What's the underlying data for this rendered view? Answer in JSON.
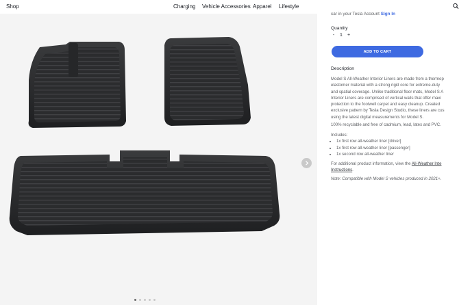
{
  "header": {
    "shop": "Shop",
    "nav": [
      "Charging",
      "Vehicle Accessories",
      "Apparel",
      "Lifestyle"
    ]
  },
  "gallery": {
    "dot_count": 5,
    "active_dot": 1
  },
  "panel": {
    "signin_prefix": "car in your Tesla Account",
    "signin_link": "Sign In",
    "quantity_label": "Quantity",
    "qty_minus": "-",
    "qty_value": "1",
    "qty_plus": "+",
    "add_to_cart": "ADD TO CART",
    "description_title": "Description",
    "description_lines": [
      "Model S All-Weather Interior Liners are made from a thermop",
      "elastomer material with a strong rigid core for extreme-duty",
      "and spatial coverage. Unlike traditional floor mats, Model S A",
      "Interior Liners are comprised of vertical walls that offer maxi",
      "protection to the footwell carpet and easy cleanup. Created",
      "exclusive pattern by Tesla Design Studio, these liners are cus",
      "using the latest digital measurements for Model S."
    ],
    "recyclable": "100% recyclable and free of cadmium, lead, latex and PVC.",
    "includes_title": "Includes:",
    "includes": [
      "1x first row all-weather liner [driver]",
      "1x first row all-weather liner [passenger]",
      "1x second row all-weather liner"
    ],
    "more_info_prefix": "For additional product information, view the",
    "more_info_link_1": "All-Weather Inte",
    "more_info_link_2": "Instructions",
    "more_info_suffix": ".",
    "note": "Note: Compatible with Model S vehicles produced in 2021+."
  }
}
